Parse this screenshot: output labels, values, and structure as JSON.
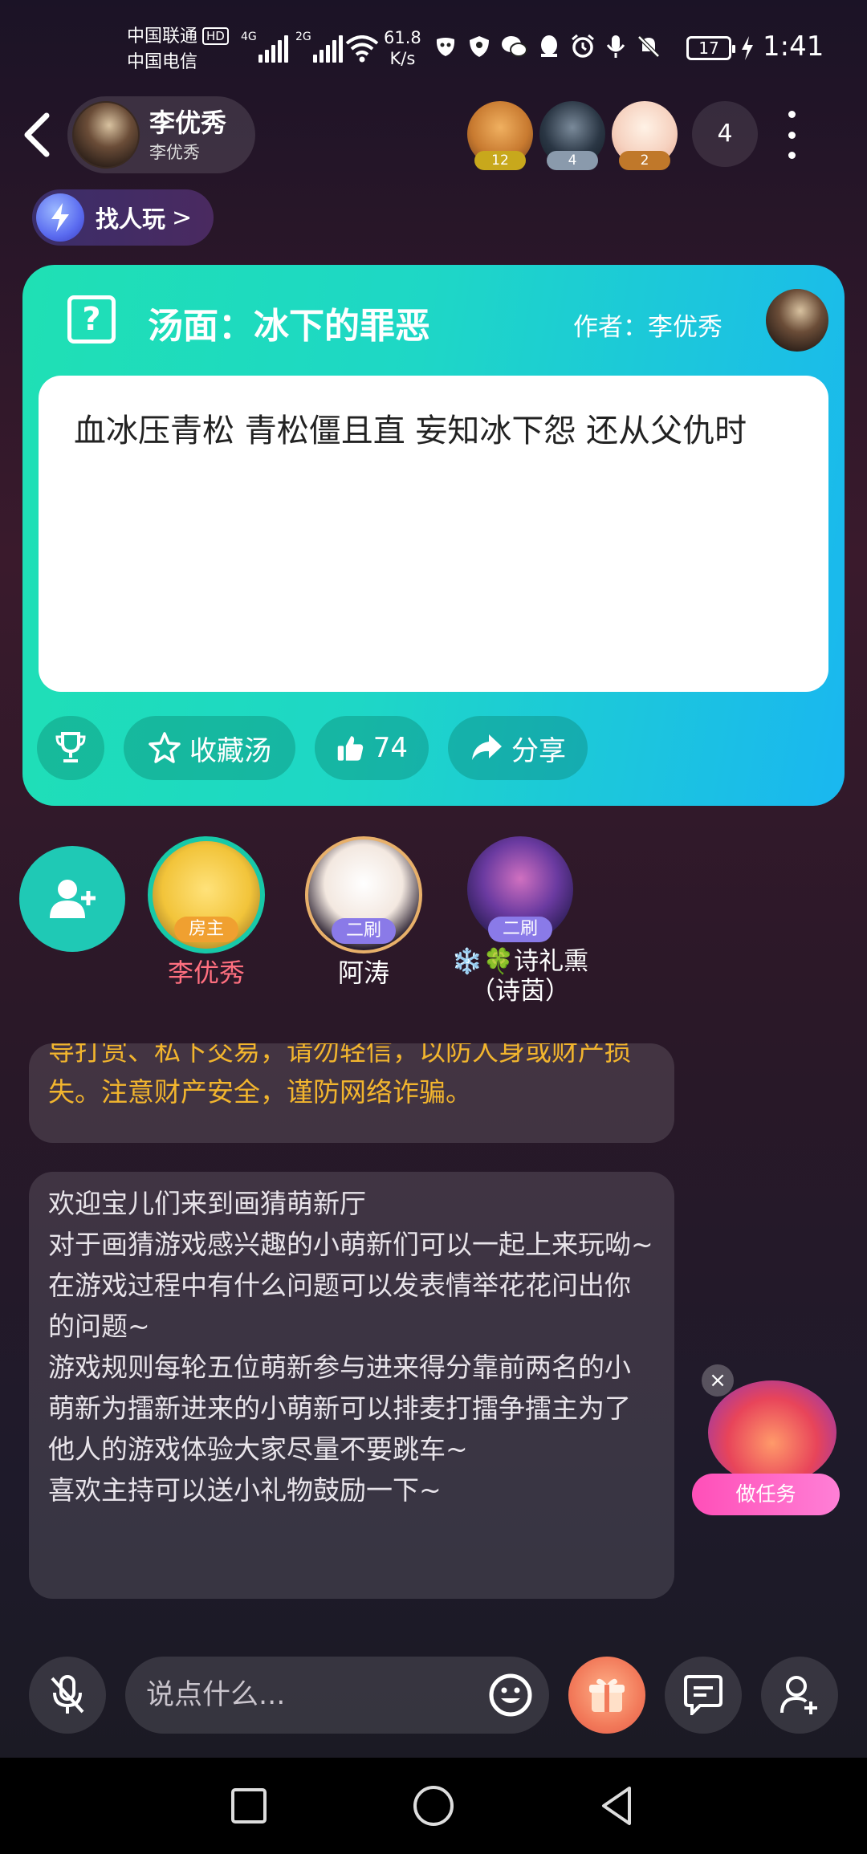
{
  "status_bar": {
    "carrier_1": "中国联通",
    "hd_badge": "HD",
    "carrier_2": "中国电信",
    "sig1_tag": "4G",
    "sig2_tag": "2G",
    "net_speed_value": "61.8",
    "net_speed_unit": "K/s",
    "battery": "17",
    "time": "1:41"
  },
  "header": {
    "host_name": "李优秀",
    "host_sub": "李优秀",
    "viewers": [
      {
        "count": "12",
        "color": "#c8a81c"
      },
      {
        "count": "4",
        "color": "#8a9aac"
      },
      {
        "count": "2",
        "color": "#c0782a"
      }
    ],
    "viewer_total": "4"
  },
  "find_play": {
    "label": "找人玩",
    "chevron": ">"
  },
  "puzzle": {
    "q_icon": "?",
    "title": "汤面：冰下的罪恶",
    "author": "作者：李优秀",
    "text": "血冰压青松 青松僵且直 妄知冰下怨 还从父仇时",
    "favorite_label": "收藏汤",
    "likes": "74",
    "share_label": "分享"
  },
  "seats": [
    {
      "name": "李优秀",
      "badge": "房主",
      "badge_color": "#f0a030",
      "name_color": "#ff6f7f"
    },
    {
      "name": "阿涛",
      "badge": "二刷",
      "badge_color": "#8a7ae8",
      "name_color": "#ffffff"
    },
    {
      "name": "❄️🍀诗礼熏（诗茵）",
      "badge": "二刷",
      "badge_color": "#8a7ae8",
      "name_color": "#ffffff"
    }
  ],
  "messages": {
    "warning": "导打赏、私下交易，请勿轻信，以防人身或财产损失。注意财产安全，谨防网络诈骗。",
    "welcome": "欢迎宝儿们来到画猜萌新厅\n对于画猜游戏感兴趣的小萌新们可以一起上来玩呦~\n在游戏过程中有什么问题可以发表情举花花问出你的问题~\n游戏规则每轮五位萌新参与进来得分靠前两名的小萌新为擂新进来的小萌新可以排麦打擂争擂主为了他人的游戏体验大家尽量不要跳车~\n喜欢主持可以送小礼物鼓励一下~"
  },
  "task": {
    "close": "×",
    "label": "做任务"
  },
  "bottom": {
    "placeholder": "说点什么..."
  },
  "colors": {
    "accent_teal": "#1fc9b5",
    "warning_text": "#f2b52e"
  }
}
